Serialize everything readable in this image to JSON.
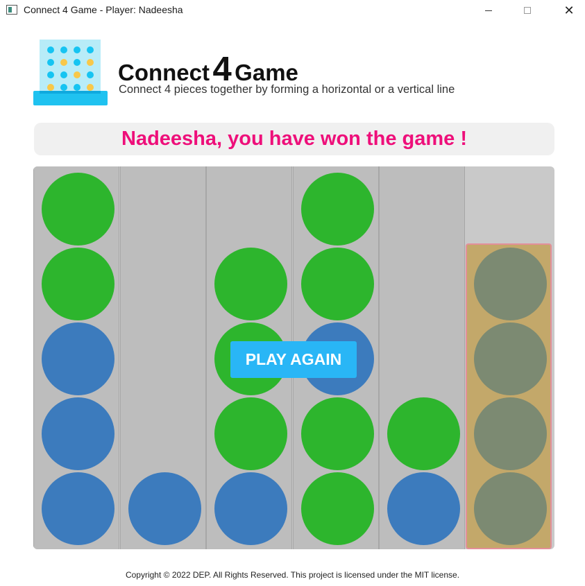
{
  "window": {
    "title": "Connect 4 Game - Player: Nadeesha",
    "minimize_icon": "minimize-icon",
    "maximize_icon": "maximize-icon",
    "close_icon": "close-icon",
    "close_glyph": "✕"
  },
  "header": {
    "logo_icon": "connect-four-board-icon",
    "title_part1": "Connect",
    "title_part2": "4",
    "title_part3": "Game",
    "subtitle": "Connect 4 pieces together by forming a horizontal or a vertical line"
  },
  "status": {
    "message": "Nadeesha, you have won the game !",
    "color": "#ee0f7a"
  },
  "board": {
    "columns": 6,
    "rows": 5,
    "winning_column": 5,
    "colors": {
      "green": "#2db52d",
      "blue": "#3c7bbd",
      "winning": "#7c8a72"
    },
    "grid_top_to_bottom": [
      [
        "green",
        "",
        "",
        "green",
        "",
        ""
      ],
      [
        "green",
        "",
        "green",
        "green",
        "",
        "winning"
      ],
      [
        "blue",
        "",
        "green",
        "blue",
        "",
        "winning"
      ],
      [
        "blue",
        "",
        "green",
        "green",
        "green",
        "winning"
      ],
      [
        "blue",
        "blue",
        "blue",
        "green",
        "blue",
        "winning"
      ]
    ]
  },
  "play_again_label": "PLAY AGAIN",
  "footer": "Copyright © 2022 DEP. All Rights Reserved. This project is licensed under the MIT license."
}
